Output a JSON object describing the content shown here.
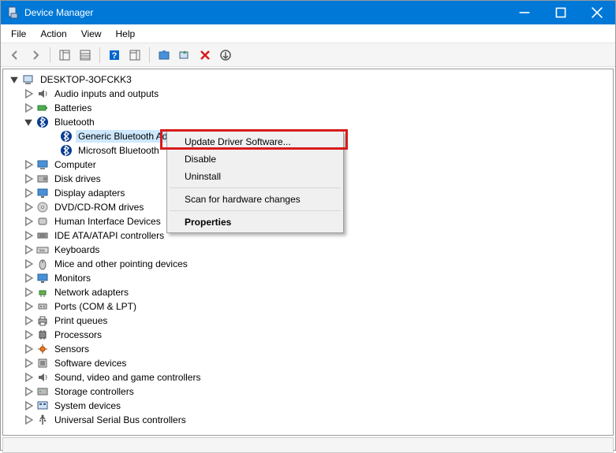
{
  "title": "Device Manager",
  "window_controls": {
    "minimize": "—",
    "maximize": "☐",
    "close": "✕"
  },
  "menus": {
    "file": "File",
    "action": "Action",
    "view": "View",
    "help": "Help"
  },
  "toolbar": {
    "back": "back",
    "forward": "forward",
    "show_hide": "show-hide-console-tree",
    "properties": "properties",
    "help": "help",
    "show_hide_action": "show-hide-action-pane",
    "update": "update-driver",
    "scan": "scan-hardware-changes",
    "uninstall": "uninstall",
    "show_hidden": "add-legacy-hardware"
  },
  "tree": {
    "root": "DESKTOP-3OFCKK3",
    "nodes": [
      {
        "label": "Audio inputs and outputs",
        "icon": "audio-icon"
      },
      {
        "label": "Batteries",
        "icon": "battery-icon"
      },
      {
        "label": "Bluetooth",
        "icon": "bluetooth-icon",
        "expanded": true,
        "children": [
          {
            "label": "Generic Bluetooth Adapter",
            "icon": "bluetooth-icon",
            "selected": true
          },
          {
            "label": "Microsoft Bluetooth",
            "icon": "bluetooth-icon"
          }
        ]
      },
      {
        "label": "Computer",
        "icon": "computer-icon"
      },
      {
        "label": "Disk drives",
        "icon": "disk-icon"
      },
      {
        "label": "Display adapters",
        "icon": "display-icon"
      },
      {
        "label": "DVD/CD-ROM drives",
        "icon": "dvd-icon"
      },
      {
        "label": "Human Interface Devices",
        "icon": "hid-icon"
      },
      {
        "label": "IDE ATA/ATAPI controllers",
        "icon": "ide-icon"
      },
      {
        "label": "Keyboards",
        "icon": "keyboard-icon"
      },
      {
        "label": "Mice and other pointing devices",
        "icon": "mouse-icon"
      },
      {
        "label": "Monitors",
        "icon": "monitor-icon"
      },
      {
        "label": "Network adapters",
        "icon": "network-icon"
      },
      {
        "label": "Ports (COM & LPT)",
        "icon": "port-icon"
      },
      {
        "label": "Print queues",
        "icon": "printer-icon"
      },
      {
        "label": "Processors",
        "icon": "cpu-icon"
      },
      {
        "label": "Sensors",
        "icon": "sensor-icon"
      },
      {
        "label": "Software devices",
        "icon": "software-icon"
      },
      {
        "label": "Sound, video and game controllers",
        "icon": "sound-icon"
      },
      {
        "label": "Storage controllers",
        "icon": "storage-icon"
      },
      {
        "label": "System devices",
        "icon": "system-icon"
      },
      {
        "label": "Universal Serial Bus controllers",
        "icon": "usb-icon"
      }
    ]
  },
  "context_menu": {
    "items": [
      {
        "label": "Update Driver Software...",
        "highlighted": true
      },
      {
        "label": "Disable"
      },
      {
        "label": "Uninstall"
      },
      {
        "sep": true
      },
      {
        "label": "Scan for hardware changes"
      },
      {
        "sep": true
      },
      {
        "label": "Properties",
        "bold": true
      }
    ]
  }
}
